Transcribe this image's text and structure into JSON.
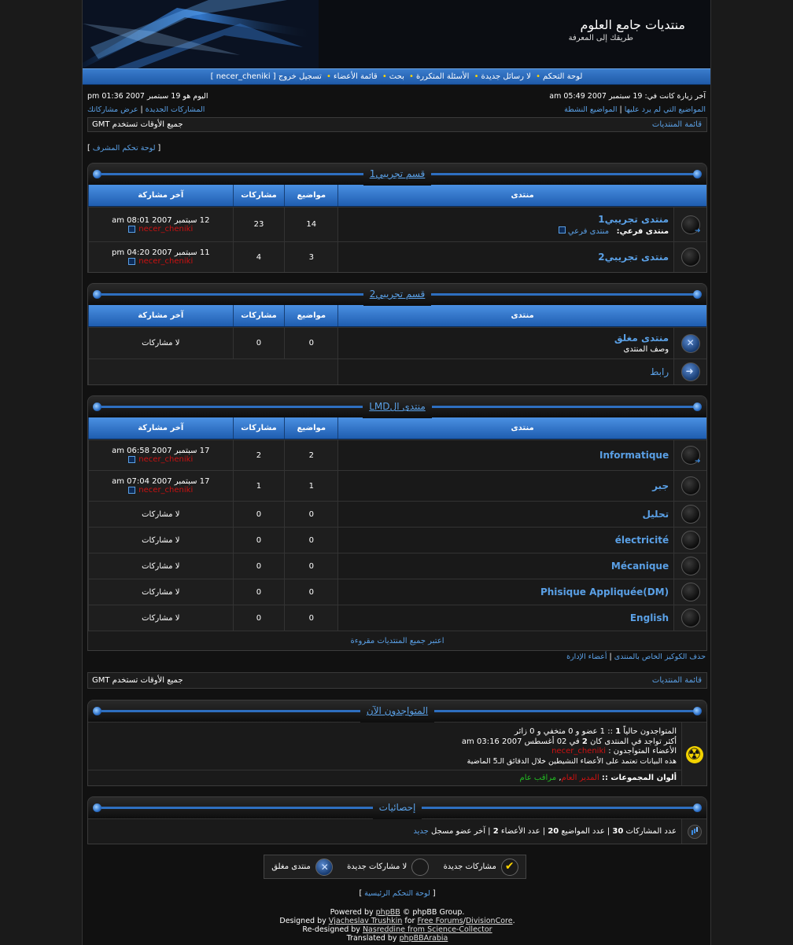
{
  "header": {
    "site_title": "منتديات جامع العلوم",
    "site_subtitle": "طريقك إلى المعرفة"
  },
  "nav": {
    "items": [
      "لوحة التحكم",
      "لا رسائل جديدة",
      "الأسئلة المتكررة",
      "بحث",
      "قائمة الأعضاء",
      "تسجيل خروج [ necer_cheniki ]"
    ]
  },
  "info": {
    "last_visit": "آخر زيارة كانت في: 19 سبتمبر 2007 05:49 am",
    "current_time": "اليوم هو 19 سبتمبر 2007 01:36 pm",
    "unanswered": "المواضيع التي لم يرد عليها",
    "active_topics": "المواضيع النشطة",
    "new_posts": "المشاركات الجديدة",
    "your_posts": "عرض مشاركاتك",
    "forum_index": "قائمة المنتديات",
    "timezone": "جميع الأوقات تستخدم GMT",
    "admin_panel": "لوحة تحكم المشرف"
  },
  "columns": {
    "forum": "منتدى",
    "topics": "مواضيع",
    "posts": "مشاركات",
    "last_post": "آخر مشاركة"
  },
  "categories": [
    {
      "title": "قسم تجريبي1",
      "forums": [
        {
          "name": "منتدى تجريبي1",
          "subforums_label": "منتدى فرعي:",
          "subforum": "منتدى فرعي",
          "topics": "14",
          "posts": "23",
          "last_date": "12 سبتمبر 2007 08:01 am",
          "last_user": "necer_cheniki",
          "icon": "new"
        },
        {
          "name": "منتدى تجريبي2",
          "topics": "3",
          "posts": "4",
          "last_date": "11 سبتمبر 2007 04:20 pm",
          "last_user": "necer_cheniki",
          "icon": "old"
        }
      ]
    },
    {
      "title": "قسم تجريبي2",
      "forums": [
        {
          "name": "منتدى مغلق",
          "desc": "وصف المنتدى",
          "topics": "0",
          "posts": "0",
          "last_none": "لا مشاركات",
          "icon": "lock"
        },
        {
          "name": "رابط",
          "icon": "link"
        }
      ]
    },
    {
      "title": "منتدى الLMD",
      "forums": [
        {
          "name": "Informatique",
          "topics": "2",
          "posts": "2",
          "last_date": "17 سبتمبر 2007 06:58 am",
          "last_user": "necer_cheniki",
          "icon": "new"
        },
        {
          "name": "جبر",
          "topics": "1",
          "posts": "1",
          "last_date": "17 سبتمبر 2007 07:04 am",
          "last_user": "necer_cheniki",
          "icon": "old"
        },
        {
          "name": "تحليل",
          "topics": "0",
          "posts": "0",
          "last_none": "لا مشاركات",
          "icon": "old"
        },
        {
          "name": "électricité",
          "topics": "0",
          "posts": "0",
          "last_none": "لا مشاركات",
          "icon": "old"
        },
        {
          "name": "Mécanique",
          "topics": "0",
          "posts": "0",
          "last_none": "لا مشاركات",
          "icon": "old"
        },
        {
          "name": "Phisique Appliquée(DM)",
          "topics": "0",
          "posts": "0",
          "last_none": "لا مشاركات",
          "icon": "old"
        },
        {
          "name": "English",
          "topics": "0",
          "posts": "0",
          "last_none": "لا مشاركات",
          "icon": "old"
        }
      ],
      "mark_read": "اعتبر جميع المنتديات مقروءة"
    }
  ],
  "below_links": {
    "delete_cookies": "حذف الكوكيز الخاص بالمنتدى",
    "team": "أعضاء الإدارة"
  },
  "online": {
    "title": "المتواجدون الآن",
    "line1_prefix": "المتواجدون حالياً",
    "line1_count": "1",
    "line1_rest": ":: 1 عضو و 0 متخفي و 0 زائر",
    "line2_prefix": "أكثر تواجد في المنتدى كان",
    "line2_count": "2",
    "line2_rest": "في 02 أغسطس 2007 03:16 am",
    "line3_prefix": "الأعضاء المتواجدون :",
    "line3_user": "necer_cheniki",
    "line4": "هذه البيانات تعتمد على الأعضاء النشيطين خلال الدقائق الـ5 الماضية",
    "legend_label": "ألوان المجموعات ::",
    "legend_admin": "المدير العام",
    "legend_mod": "مراقب عام"
  },
  "stats": {
    "title": "إحصائيات",
    "posts_label": "عدد المشاركات",
    "posts": "30",
    "topics_label": "عدد المواضيع",
    "topics": "20",
    "members_label": "عدد الأعضاء",
    "members": "2",
    "newest_label": "آخر عضو مسجل",
    "newest": "جديد"
  },
  "legend": {
    "new_posts": "مشاركات جديدة",
    "no_new_posts": "لا مشاركات جديدة",
    "locked": "منتدى مغلق"
  },
  "footer": {
    "admin_index": "لوحة التحكم الرئيسية",
    "powered_by": "Powered by",
    "phpbb": "phpBB",
    "phpbb_group": "© phpBB Group.",
    "designed_by": "Designed by",
    "designer": "Vjacheslav Trushkin",
    "for": "for",
    "free_forums": "Free Forums",
    "division": "DivisionCore",
    "redesigned_by": "Re-designed by",
    "redesigner": "Nasreddine from Science-Collector",
    "translated_by": "Translated by",
    "translator": "phpBBArabia"
  }
}
